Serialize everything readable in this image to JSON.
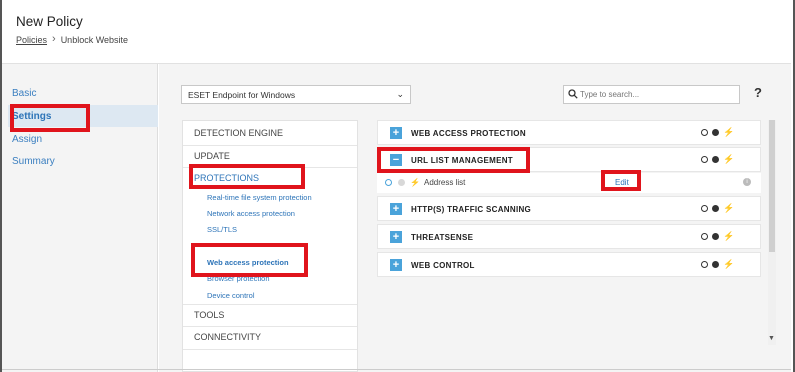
{
  "header": {
    "title": "New Policy",
    "breadcrumb_root": "Policies",
    "breadcrumb_current": "Unblock Website"
  },
  "left_nav": {
    "items": [
      {
        "label": "Basic"
      },
      {
        "label": "Settings"
      },
      {
        "label": "Assign"
      },
      {
        "label": "Summary"
      }
    ],
    "active": "Settings"
  },
  "toolbar": {
    "product_select": "ESET Endpoint for Windows",
    "search_placeholder": "Type to search...",
    "help_label": "?"
  },
  "categories": {
    "detection_engine": "DETECTION ENGINE",
    "update": "UPDATE",
    "protections": "PROTECTIONS",
    "sub_items": [
      "Real-time file system protection",
      "Network access protection",
      "SSL/TLS",
      "Web access protection",
      "Browser protection",
      "Device control"
    ],
    "tools": "TOOLS",
    "connectivity": "CONNECTIVITY"
  },
  "sections": [
    {
      "label": "WEB ACCESS PROTECTION",
      "expanded": false
    },
    {
      "label": "URL LIST MANAGEMENT",
      "expanded": true
    },
    {
      "label": "HTTP(S) TRAFFIC SCANNING",
      "expanded": false
    },
    {
      "label": "THREATSENSE",
      "expanded": false
    },
    {
      "label": "WEB CONTROL",
      "expanded": false
    }
  ],
  "url_list": {
    "address_list_label": "Address list",
    "edit_label": "Edit"
  },
  "icons": {
    "expand": "+",
    "collapse": "−",
    "bolt": "⚡",
    "caret": "⌄"
  },
  "colors": {
    "accent": "#4aa3da",
    "link": "#2d74b8",
    "highlight": "#e0141c"
  }
}
